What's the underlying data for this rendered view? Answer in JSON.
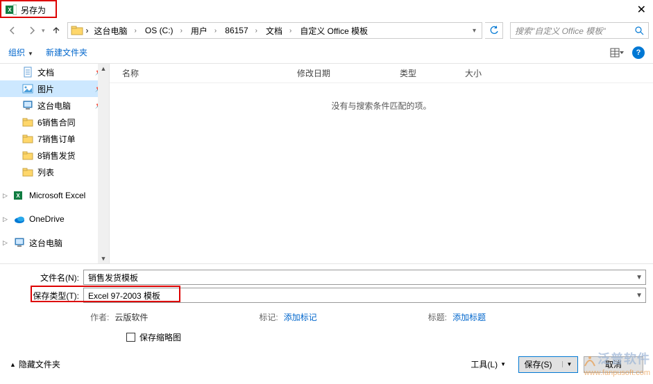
{
  "window": {
    "title": "另存为"
  },
  "breadcrumbs": [
    "这台电脑",
    "OS (C:)",
    "用户",
    "86157",
    "文档",
    "自定义 Office 模板"
  ],
  "search": {
    "placeholder": "搜索\"自定义 Office 模板\""
  },
  "toolbar": {
    "organize": "组织",
    "new_folder": "新建文件夹"
  },
  "columns": {
    "name": "名称",
    "date": "修改日期",
    "type": "类型",
    "size": "大小"
  },
  "empty_msg": "没有与搜索条件匹配的项。",
  "sidebar": {
    "items": [
      {
        "label": "文档",
        "icon": "doc",
        "pinned": true
      },
      {
        "label": "图片",
        "icon": "pic",
        "pinned": true,
        "selected": true
      },
      {
        "label": "这台电脑",
        "icon": "pc",
        "pinned": true
      },
      {
        "label": "6销售合同",
        "icon": "folder"
      },
      {
        "label": "7销售订单",
        "icon": "folder"
      },
      {
        "label": "8销售发货",
        "icon": "folder"
      },
      {
        "label": "列表",
        "icon": "folder"
      },
      {
        "label": "Microsoft Excel",
        "icon": "excel",
        "expandable": true,
        "spaced": true
      },
      {
        "label": "OneDrive",
        "icon": "onedrive",
        "expandable": true,
        "spaced": true
      },
      {
        "label": "这台电脑",
        "icon": "pc",
        "expandable": true,
        "spaced": true
      }
    ]
  },
  "filename": {
    "label": "文件名(N):",
    "value": "销售发货模板"
  },
  "filetype": {
    "label": "保存类型(T):",
    "value": "Excel 97-2003 模板"
  },
  "meta": {
    "author_label": "作者:",
    "author_value": "云版软件",
    "tags_label": "标记:",
    "tags_link": "添加标记",
    "title_label": "标题:",
    "title_link": "添加标题"
  },
  "thumbnail_label": "保存缩略图",
  "footer": {
    "hide": "隐藏文件夹",
    "tools": "工具(L)",
    "save": "保存(S)",
    "cancel": "取消"
  },
  "watermark": {
    "line1": "泛普软件",
    "line2": "www.fanpusoft.com"
  }
}
